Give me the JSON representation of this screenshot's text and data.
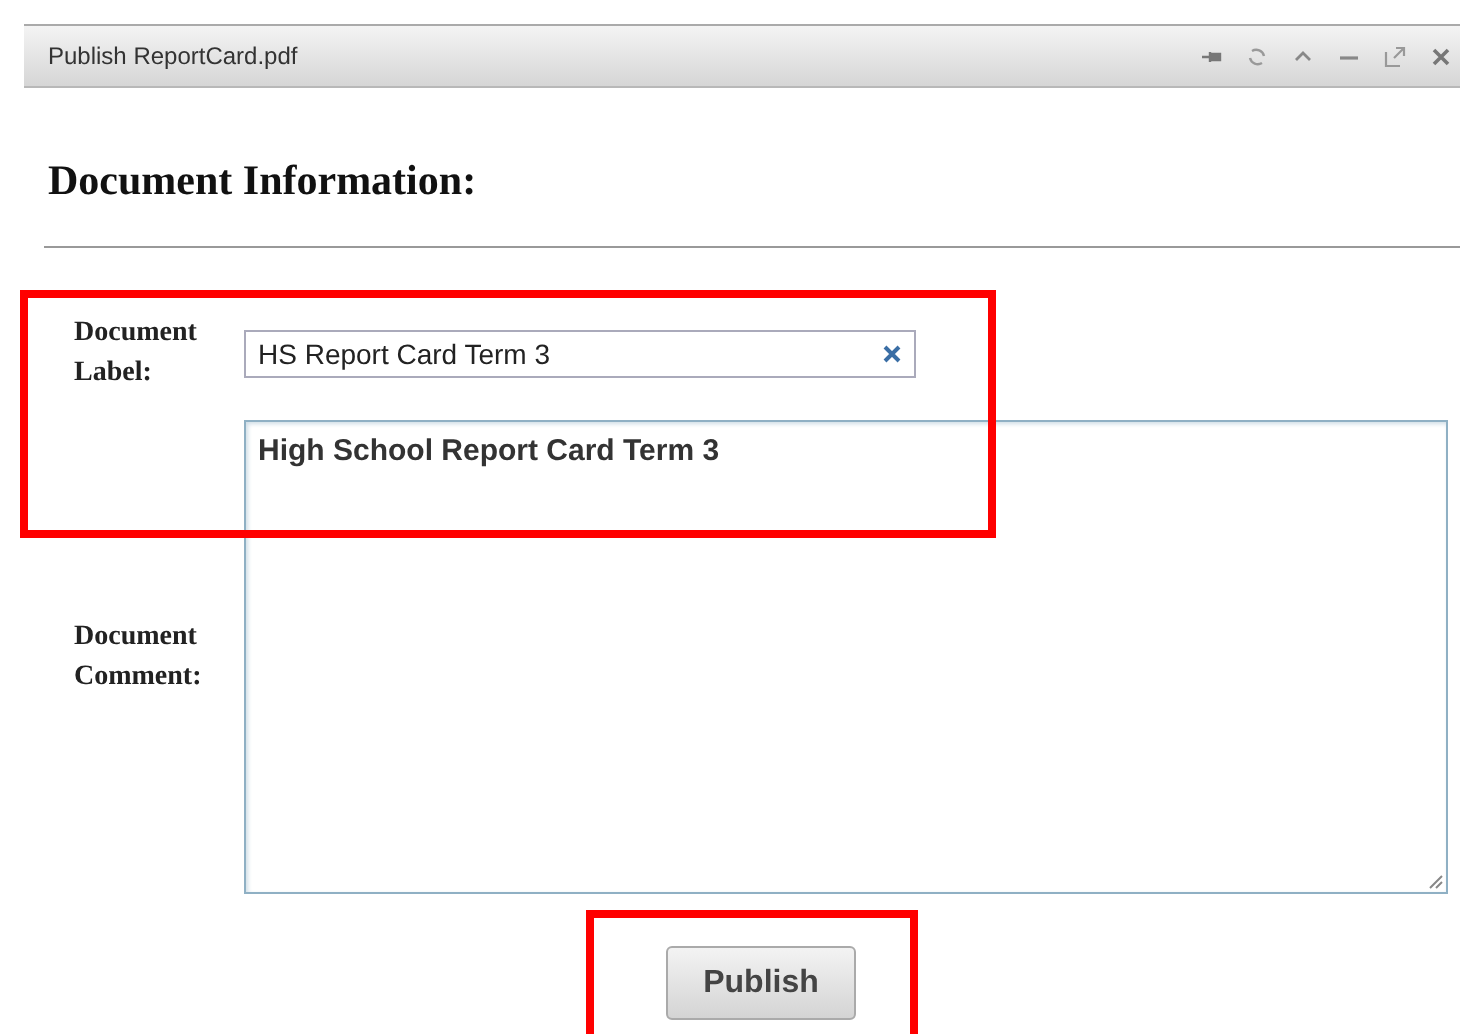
{
  "window": {
    "title": "Publish ReportCard.pdf"
  },
  "heading": "Document Information:",
  "label_field": {
    "label": "Document Label:",
    "value": "HS Report Card Term 3"
  },
  "comment_field": {
    "label": "Document Comment:",
    "value": "High School Report Card Term 3"
  },
  "publish_button": "Publish"
}
